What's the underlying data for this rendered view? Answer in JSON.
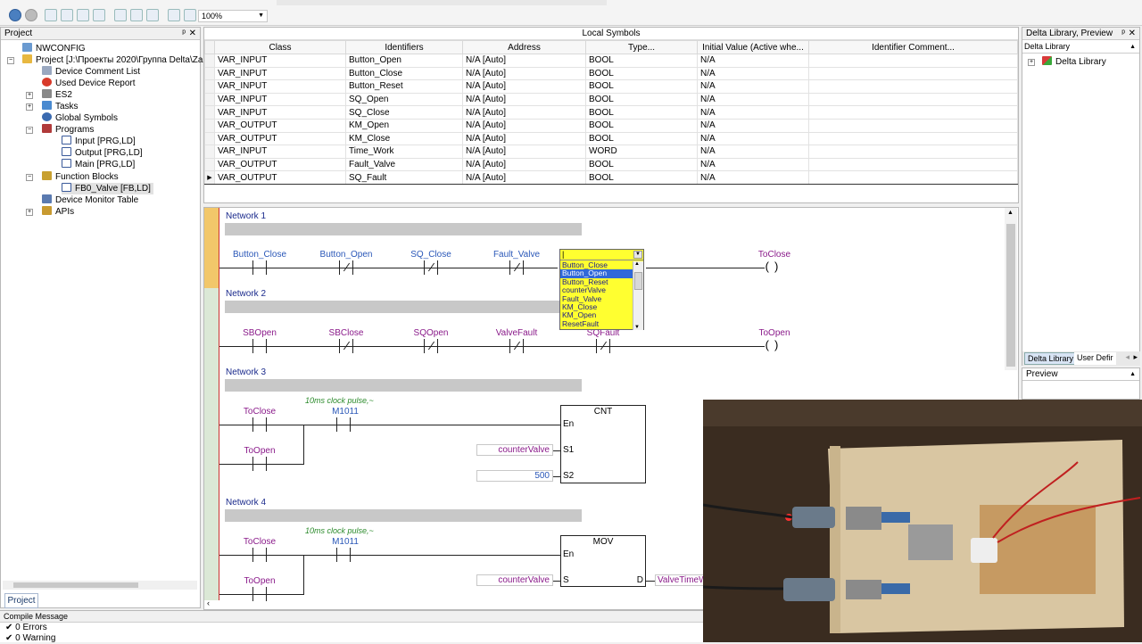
{
  "toolbar": {
    "zoom": "100%"
  },
  "project": {
    "title": "Project",
    "tab": "Project",
    "items": [
      {
        "label": "NWCONFIG"
      },
      {
        "label": "Project [J:\\Проекты 2020\\Группа Delta\\Za"
      },
      {
        "label": "Device Comment List"
      },
      {
        "label": "Used Device Report"
      },
      {
        "label": "ES2"
      },
      {
        "label": "Tasks"
      },
      {
        "label": "Global Symbols"
      },
      {
        "label": "Programs"
      },
      {
        "label": "Input [PRG,LD]"
      },
      {
        "label": "Output [PRG,LD]"
      },
      {
        "label": "Main [PRG,LD]"
      },
      {
        "label": "Function Blocks"
      },
      {
        "label": "FB0_Valve [FB,LD]"
      },
      {
        "label": "Device Monitor Table"
      },
      {
        "label": "APIs"
      }
    ]
  },
  "symbols": {
    "title": "Local Symbols",
    "headers": [
      "Class",
      "Identifiers",
      "Address",
      "Type...",
      "Initial Value (Active whe...",
      "Identifier Comment..."
    ],
    "rows": [
      [
        "VAR_INPUT",
        "Button_Open",
        "N/A [Auto]",
        "BOOL",
        "N/A",
        ""
      ],
      [
        "VAR_INPUT",
        "Button_Close",
        "N/A [Auto]",
        "BOOL",
        "N/A",
        ""
      ],
      [
        "VAR_INPUT",
        "Button_Reset",
        "N/A [Auto]",
        "BOOL",
        "N/A",
        ""
      ],
      [
        "VAR_INPUT",
        "SQ_Open",
        "N/A [Auto]",
        "BOOL",
        "N/A",
        ""
      ],
      [
        "VAR_INPUT",
        "SQ_Close",
        "N/A [Auto]",
        "BOOL",
        "N/A",
        ""
      ],
      [
        "VAR_OUTPUT",
        "KM_Open",
        "N/A [Auto]",
        "BOOL",
        "N/A",
        ""
      ],
      [
        "VAR_OUTPUT",
        "KM_Close",
        "N/A [Auto]",
        "BOOL",
        "N/A",
        ""
      ],
      [
        "VAR_INPUT",
        "Time_Work",
        "N/A [Auto]",
        "WORD",
        "N/A",
        ""
      ],
      [
        "VAR_OUTPUT",
        "Fault_Valve",
        "N/A [Auto]",
        "BOOL",
        "N/A",
        ""
      ],
      [
        "VAR_OUTPUT",
        "SQ_Fault",
        "N/A [Auto]",
        "BOOL",
        "N/A",
        ""
      ]
    ]
  },
  "ladder": {
    "n1": {
      "label": "Network 1",
      "c1": "Button_Close",
      "c2": "Button_Open",
      "c3": "SQ_Close",
      "c4": "Fault_Valve",
      "coil": "ToClose"
    },
    "n2": {
      "label": "Network 2",
      "c1": "SBOpen",
      "c2": "SBClose",
      "c3": "SQOpen",
      "c4": "ValveFault",
      "c5": "SQFault",
      "coil": "ToOpen"
    },
    "n3": {
      "label": "Network 3",
      "clock": "10ms clock pulse,~",
      "c1": "ToClose",
      "c2": "M1011",
      "c3": "ToOpen",
      "block": "CNT",
      "en": "En",
      "s1": "S1",
      "s2": "S2",
      "s1val": "counterValve",
      "s2val": "500"
    },
    "n4": {
      "label": "Network 4",
      "clock": "10ms clock pulse,~",
      "c1": "ToClose",
      "c2": "M1011",
      "c3": "ToOpen",
      "block": "MOV",
      "en": "En",
      "s": "S",
      "d": "D",
      "sval": "counterValve",
      "dval": "ValveTimeW"
    }
  },
  "dropdown": {
    "value": "|",
    "items": [
      "Button_Close",
      "Button_Open",
      "Button_Reset",
      "counterValve",
      "Fault_Valve",
      "KM_Close",
      "KM_Open",
      "ResetFault"
    ],
    "selected": "Button_Open"
  },
  "library": {
    "title": "Delta Library, Preview",
    "subtitle": "Delta Library",
    "root": "Delta Library",
    "tab1": "Delta Library",
    "tab2": "User Defir",
    "preview": "Preview"
  },
  "compile": {
    "title": "Compile Message",
    "line1": "0 Errors",
    "line2": "0 Warning"
  }
}
